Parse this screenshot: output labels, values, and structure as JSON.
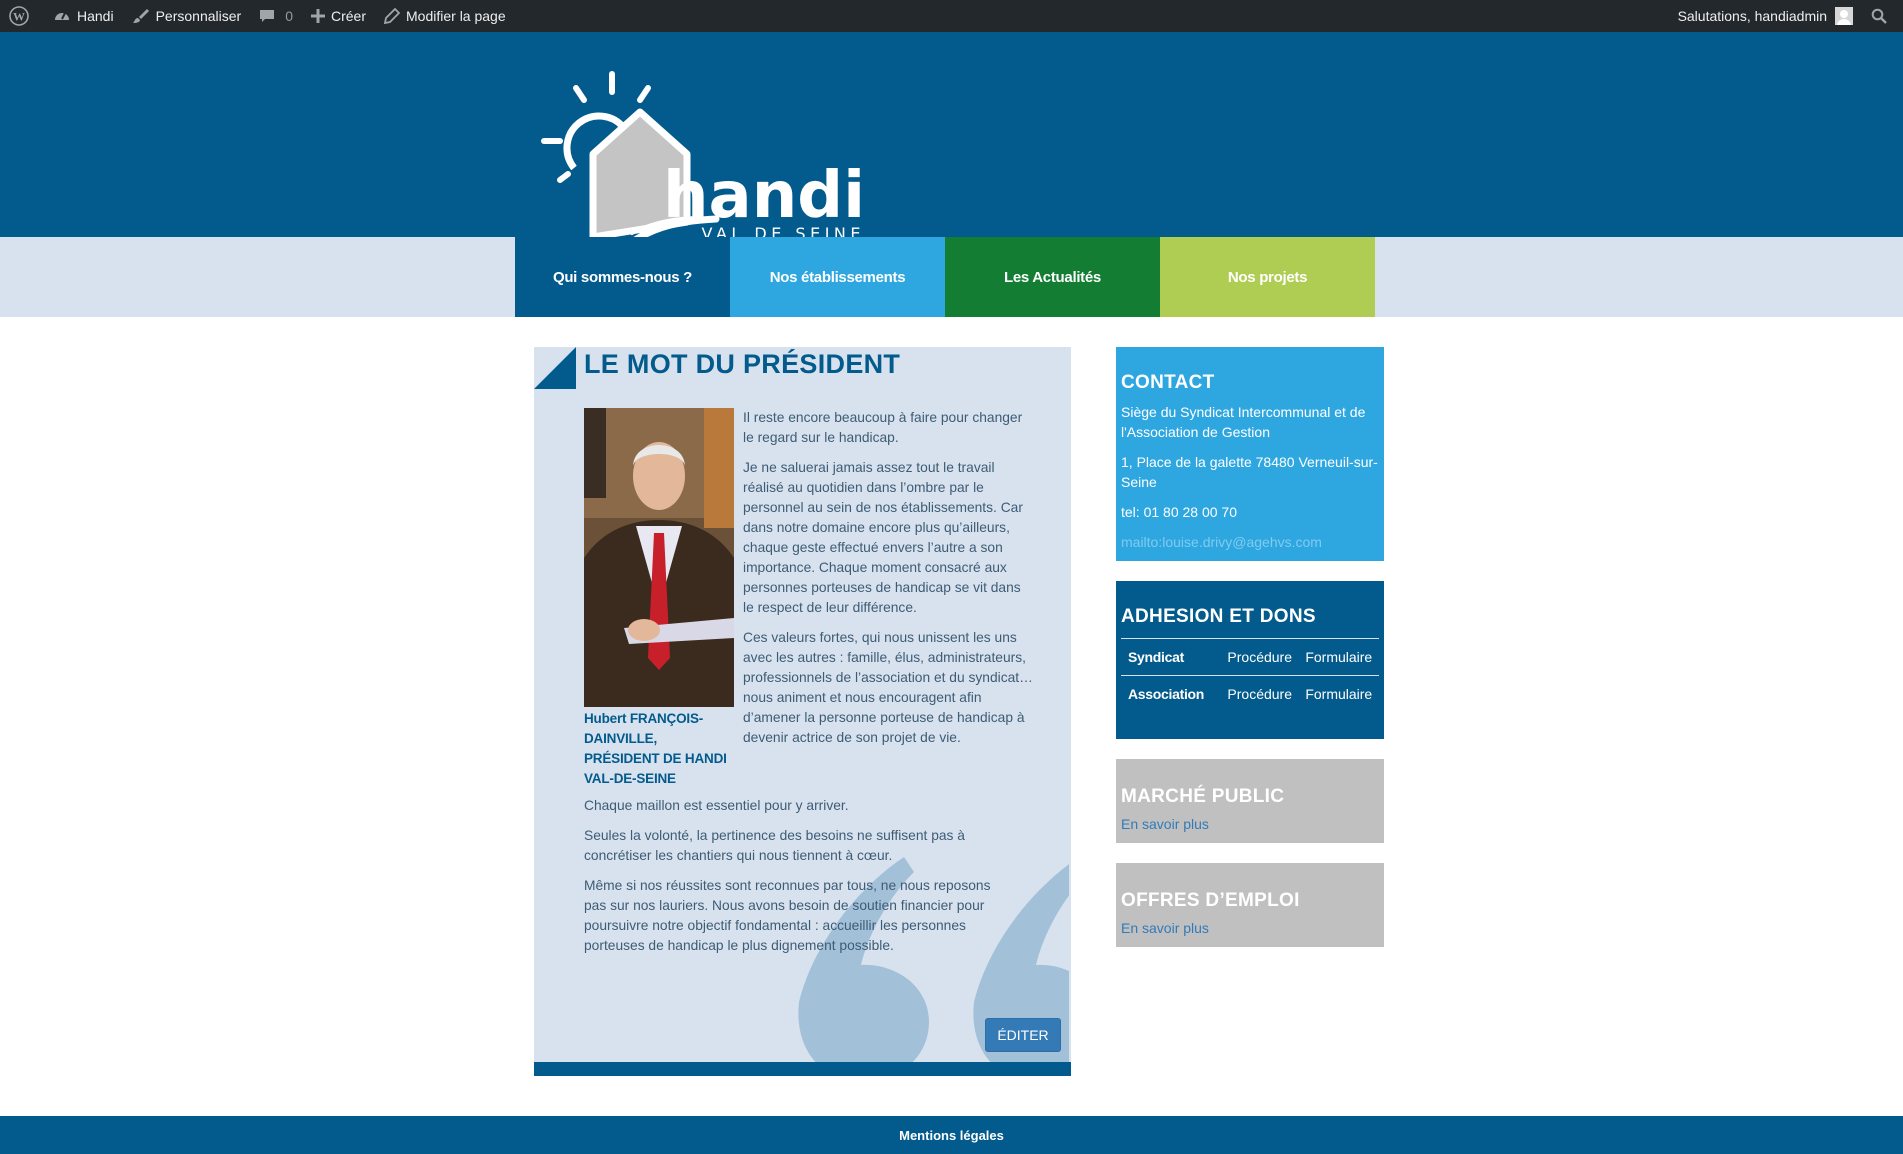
{
  "admin_bar": {
    "site_name": "Handi",
    "customize": "Personnaliser",
    "comments_count": "0",
    "new": "Créer",
    "edit_page": "Modifier la page",
    "greeting": "Salutations, handiadmin"
  },
  "logo": {
    "name": "handi",
    "tagline": "VAL DE SEINE"
  },
  "nav": {
    "items": [
      {
        "label": "Qui sommes-nous ?",
        "color": "#035b8d"
      },
      {
        "label": "Nos établissements",
        "color": "#2ea7e0"
      },
      {
        "label": "Les Actualités",
        "color": "#127d33"
      },
      {
        "label": "Nos projets",
        "color": "#b0cd53"
      }
    ]
  },
  "article": {
    "title": "LE MOT DU PRÉSIDENT",
    "caption": "Hubert FRANÇOIS-DAINVILLE, PRÉSIDENT DE HANDI VAL-DE-SEINE",
    "paragraphs_side": [
      "Il reste encore beaucoup à faire pour changer le regard sur le handicap.",
      "Je ne saluerai jamais assez tout le travail réalisé au quotidien dans l’ombre par le personnel au sein de nos établissements. Car dans notre domaine encore plus qu’ailleurs, chaque geste effectué envers l’autre a son importance. Chaque moment consacré aux personnes porteuses de handicap se vit dans le respect de leur différence.",
      "Ces valeurs fortes, qui nous unissent les uns avec les autres : famille, élus, administrateurs, professionnels de l’association et du syndicat… nous animent et nous encouragent afin d’amener la personne porteuse de handicap à devenir actrice de son projet de vie."
    ],
    "paragraphs_full": [
      "Chaque maillon est essentiel pour y arriver.",
      "Seules la volonté, la pertinence des besoins ne suffisent pas à concrétiser les chantiers qui nous tiennent à cœur.",
      "Même si nos réussites sont reconnues par tous, ne nous reposons pas sur nos lauriers. Nous avons besoin de soutien financier pour poursuivre notre objectif fondamental : accueillir les personnes porteuses de handicap le plus dignement possible."
    ],
    "edit_label": "ÉDITER"
  },
  "sidebar": {
    "contact": {
      "title": "CONTACT",
      "org": "Siège du Syndicat Intercommunal et de l'Association de Gestion",
      "address": "1, Place de la galette 78480 Verneuil-sur-Seine",
      "tel": "tel: 01 80 28 00 70",
      "mailto": "mailto:louise.drivy@agehvs.com"
    },
    "adhesion": {
      "title": "ADHESION ET DONS",
      "rows": [
        {
          "label": "Syndicat",
          "procedure": "Procédure",
          "form": "Formulaire"
        },
        {
          "label": "Association",
          "procedure": "Procédure",
          "form": "Formulaire"
        }
      ]
    },
    "marche": {
      "title": "MARCHÉ PUBLIC",
      "link": "En savoir plus"
    },
    "offres": {
      "title": "OFFRES D’EMPLOI",
      "link": "En savoir plus"
    }
  },
  "footer": {
    "link": "Mentions légales"
  }
}
